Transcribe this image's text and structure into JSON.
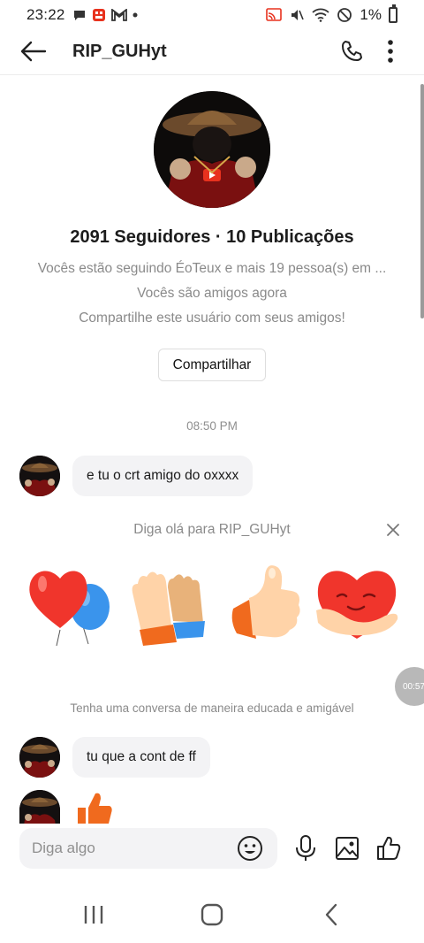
{
  "status_bar": {
    "time": "23:22",
    "battery": "1%"
  },
  "header": {
    "title": "RIP_GUHyt"
  },
  "profile": {
    "stats": "2091 Seguidores · 10 Publicações",
    "following_info": "Vocês estão seguindo ÉoTeux e mais 19 pessoa(s) em ...",
    "friends_info": "Vocês são amigos agora",
    "share_prompt": "Compartilhe este usuário com seus amigos!",
    "share_button": "Compartilhar"
  },
  "chat": {
    "timestamp": "08:50 PM",
    "messages": [
      {
        "text": "e tu o crt amigo do oxxxx"
      },
      {
        "text": "tu que a cont de ff"
      }
    ],
    "say_hi": "Diga olá para RIP_GUHyt",
    "polite_notice": "Tenha uma conversa de maneira educada e amigável",
    "video_timer": "00:57"
  },
  "composer": {
    "placeholder": "Diga algo"
  },
  "colors": {
    "accent_orange": "#f06a1e",
    "bubble_bg": "#f3f3f5"
  }
}
